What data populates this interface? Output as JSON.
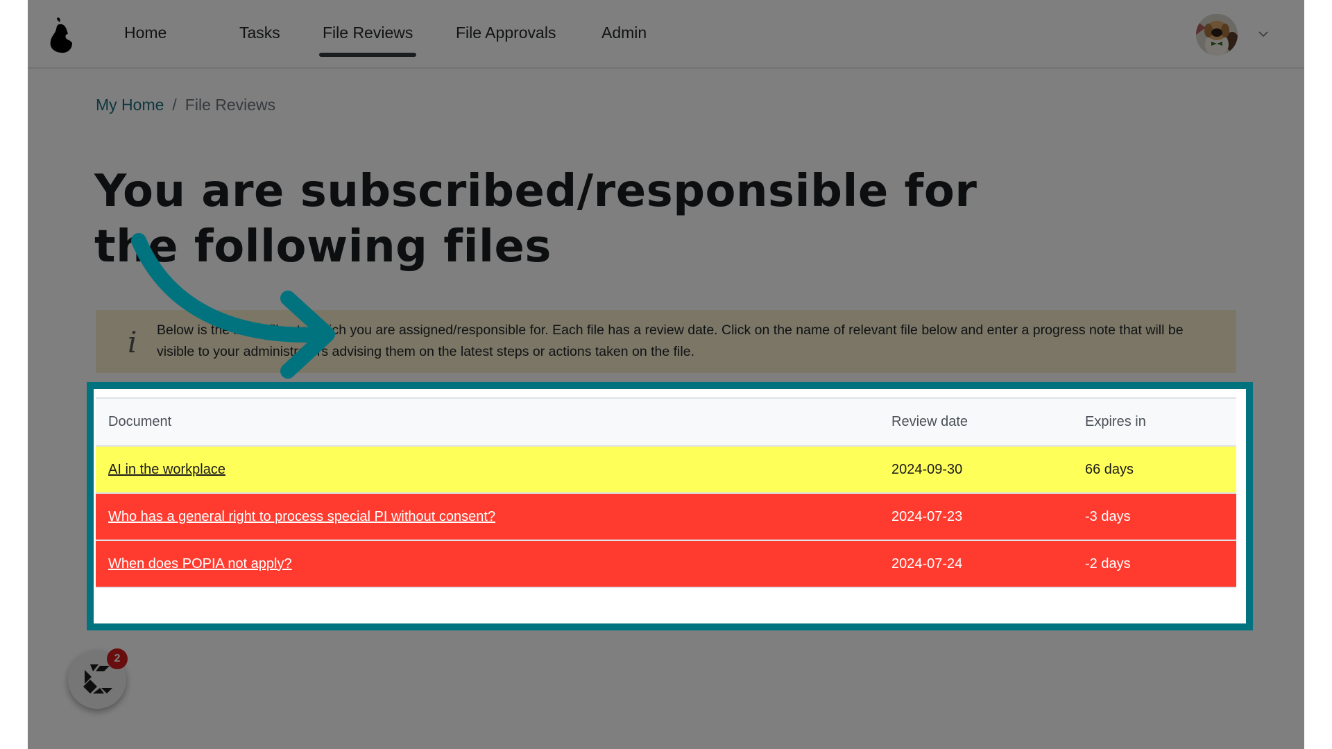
{
  "nav": {
    "logo": "pear-logo-icon",
    "items": [
      {
        "label": "Home",
        "active": false
      },
      {
        "label": "Tasks",
        "active": false
      },
      {
        "label": "File Reviews",
        "active": true
      },
      {
        "label": "File Approvals",
        "active": false
      },
      {
        "label": "Admin",
        "active": false
      }
    ],
    "avatar": "user-avatar-dog",
    "menu_icon": "chevron-down-icon"
  },
  "breadcrumb": {
    "home": "My Home",
    "separator": "/",
    "current": "File Reviews"
  },
  "page": {
    "title_line1": "You are subscribed/responsible for",
    "title_line2": "the following files"
  },
  "info": {
    "icon": "info-icon",
    "icon_glyph": "i",
    "text": "Below is the list of files to which you are assigned/responsible for. Each file has a review date. Click on the name of relevant file below and enter a progress note that will be visible to your administrators advising them on the latest steps or actions taken on the file."
  },
  "table": {
    "headers": [
      "Document",
      "Review date",
      "Expires in"
    ],
    "rows": [
      {
        "document": "AI in the workplace",
        "review_date": "2024-09-30",
        "expires_in": "66 days",
        "status": "warning"
      },
      {
        "document": "Who has a general right to process special PI without consent?",
        "review_date": "2024-07-23",
        "expires_in": "-3 days",
        "status": "expired"
      },
      {
        "document": "When does POPIA not apply?",
        "review_date": "2024-07-24",
        "expires_in": "-2 days",
        "status": "expired"
      }
    ]
  },
  "widget": {
    "icon": "chat-launcher-icon",
    "badge_count": "2"
  },
  "colors": {
    "highlight": "#00737f",
    "warning_row": "#ffff5a",
    "expired_row": "#ff3b2f",
    "breadcrumb_link": "#1d6c7a"
  }
}
